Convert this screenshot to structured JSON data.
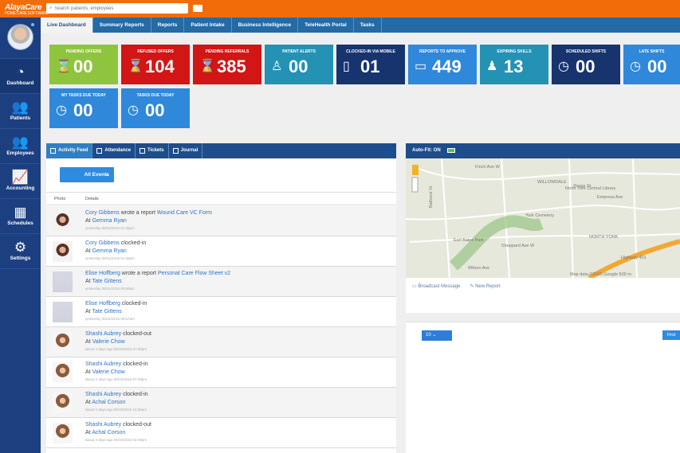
{
  "brand": {
    "name": "AlayaCare"
  },
  "topbar": {
    "search_placeholder": "Search patients, employees"
  },
  "sidebar": {
    "items": [
      {
        "label": "Dashboard",
        "icon": "gauge-icon"
      },
      {
        "label": "Patients",
        "icon": "users-icon"
      },
      {
        "label": "Employees",
        "icon": "team-icon"
      },
      {
        "label": "Accounting",
        "icon": "chart-icon"
      },
      {
        "label": "Schedules",
        "icon": "calendar-icon"
      },
      {
        "label": "Settings",
        "icon": "gear-icon"
      }
    ]
  },
  "tabs": [
    "Live Dashboard",
    "Summary Reports",
    "Reports",
    "Patient Intake",
    "Business Intelligence",
    "TeleHealth Portal",
    "Tasks"
  ],
  "kpis": [
    {
      "label": "Pending Offers",
      "value": "00",
      "color": "#8fc43f",
      "icon": "hourglass-icon"
    },
    {
      "label": "Refused Offers",
      "value": "104",
      "color": "#d21515",
      "icon": "hourglass-icon"
    },
    {
      "label": "Pending Referrals",
      "value": "385",
      "color": "#d21515",
      "icon": "hourglass-icon"
    },
    {
      "label": "Patient Alerts",
      "value": "00",
      "color": "#2392b5",
      "icon": "person-icon"
    },
    {
      "label": "Clocked-In via Mobile",
      "value": "01",
      "color": "#17346f",
      "icon": "mobile-icon"
    },
    {
      "label": "Reports to Approve",
      "value": "449",
      "color": "#2f88da",
      "icon": "book-icon"
    },
    {
      "label": "Expiring Skills",
      "value": "13",
      "color": "#2392b5",
      "icon": "user-icon"
    },
    {
      "label": "Scheduled Shifts",
      "value": "00",
      "color": "#17346f",
      "icon": "clock-icon"
    },
    {
      "label": "Late Shifts",
      "value": "00",
      "color": "#2f88da",
      "icon": "clock-icon"
    },
    {
      "label": "My Tasks Due Today",
      "value": "00",
      "color": "#2f88da",
      "icon": "clock-icon"
    },
    {
      "label": "Tasks Due Today",
      "value": "00",
      "color": "#2f88da",
      "icon": "clock-icon"
    }
  ],
  "activity": {
    "tabs": [
      "Activity Feed",
      "Attendance",
      "Tickets",
      "Journal"
    ],
    "filter": "All Events",
    "columns": [
      "Photo",
      "Details"
    ],
    "rows": [
      {
        "name": "Cory Gibbens",
        "action": "wrote a report",
        "target": "Wound Care VC Form",
        "location": "Gemma Ryan",
        "time": "yesterday  08/11/2015 01:46pm",
        "photo": "female"
      },
      {
        "name": "Cory Gibbens",
        "action": "clocked-in",
        "target": "",
        "location": "Gemma Ryan",
        "time": "yesterday  08/11/2015 01:45pm",
        "photo": "female"
      },
      {
        "name": "Elise Hoffberg",
        "action": "wrote a report",
        "target": "Personal Care Flow Sheet v2",
        "location": "Tate Gittens",
        "time": "yesterday  08/11/2015 09:59am",
        "photo": "blank"
      },
      {
        "name": "Elise Hoffberg",
        "action": "clocked-in",
        "target": "",
        "location": "Tate Gittens",
        "time": "yesterday  08/11/2015 09:57am",
        "photo": "blank"
      },
      {
        "name": "Shashi Aubrey",
        "action": "clocked-out",
        "target": "",
        "location": "Valerie Chow",
        "time": "about 2 days ago  08/10/2015 07:30pm",
        "photo": "brown"
      },
      {
        "name": "Shashi Aubrey",
        "action": "clocked-in",
        "target": "",
        "location": "Valerie Chow",
        "time": "about 2 days ago  08/10/2015 07:29pm",
        "photo": "brown"
      },
      {
        "name": "Shashi Aubrey",
        "action": "clocked-in",
        "target": "",
        "location": "Achal Corson",
        "time": "about 2 days ago  08/10/2015 10:36am",
        "photo": "brown"
      },
      {
        "name": "Shashi Aubrey",
        "action": "clocked-out",
        "target": "",
        "location": "Achal Corson",
        "time": "about 3 days ago  08/10/2015 02:49pm",
        "photo": "brown"
      }
    ]
  },
  "map": {
    "title": "Auto-Fit: ON",
    "labels": [
      "Finch Ave W",
      "Yonge St",
      "NORTH YORK",
      "WILLOWDALE",
      "Sheppard Ave W",
      "York Cemetery",
      "Earl Bales Park",
      "North York Central Library",
      "Highway 401",
      "Bathurst St",
      "Wilson Ave",
      "Empress Ave"
    ],
    "credits": "Map data ©2015 Google  500 m",
    "tools": [
      "Broadcast Message",
      "New Report"
    ]
  },
  "pager": {
    "page_size": "10",
    "first_label": "First"
  }
}
